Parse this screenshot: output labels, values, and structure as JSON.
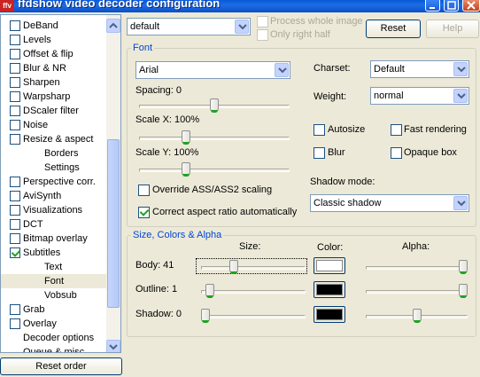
{
  "window": {
    "title": "ffdshow video decoder configuration",
    "icon_text": "ffv"
  },
  "sidebar": {
    "items": [
      {
        "label": "DeBand",
        "checkbox": true,
        "checked": false
      },
      {
        "label": "Levels",
        "checkbox": true,
        "checked": false
      },
      {
        "label": "Offset & flip",
        "checkbox": true,
        "checked": false
      },
      {
        "label": "Blur & NR",
        "checkbox": true,
        "checked": false
      },
      {
        "label": "Sharpen",
        "checkbox": true,
        "checked": false
      },
      {
        "label": "Warpsharp",
        "checkbox": true,
        "checked": false
      },
      {
        "label": "DScaler filter",
        "checkbox": true,
        "checked": false
      },
      {
        "label": "Noise",
        "checkbox": true,
        "checked": false
      },
      {
        "label": "Resize & aspect",
        "checkbox": true,
        "checked": false
      },
      {
        "label": "Borders",
        "checkbox": false,
        "sub": true
      },
      {
        "label": "Settings",
        "checkbox": false,
        "sub": true
      },
      {
        "label": "Perspective corr.",
        "checkbox": true,
        "checked": false
      },
      {
        "label": "AviSynth",
        "checkbox": true,
        "checked": false
      },
      {
        "label": "Visualizations",
        "checkbox": true,
        "checked": false
      },
      {
        "label": "DCT",
        "checkbox": true,
        "checked": false
      },
      {
        "label": "Bitmap overlay",
        "checkbox": true,
        "checked": false
      },
      {
        "label": "Subtitles",
        "checkbox": true,
        "checked": true
      },
      {
        "label": "Text",
        "checkbox": false,
        "sub": true
      },
      {
        "label": "Font",
        "checkbox": false,
        "sub": true,
        "selected": true
      },
      {
        "label": "Vobsub",
        "checkbox": false,
        "sub": true
      },
      {
        "label": "Grab",
        "checkbox": true,
        "checked": false
      },
      {
        "label": "Overlay",
        "checkbox": true,
        "checked": false
      },
      {
        "label": "Decoder options",
        "checkbox": false
      },
      {
        "label": "Queue & misc",
        "checkbox": false
      }
    ],
    "reset_order_label": "Reset order"
  },
  "top": {
    "preset_value": "default",
    "process_whole_image": "Process whole image",
    "only_right_half": "Only right half",
    "reset_label": "Reset",
    "help_label": "Help"
  },
  "font": {
    "group_title": "Font",
    "font_name": "Arial",
    "spacing_label": "Spacing: 0",
    "scale_x_label": "Scale X: 100%",
    "scale_y_label": "Scale Y: 100%",
    "override_label": "Override ASS/ASS2 scaling",
    "override_checked": false,
    "correct_aspect_label": "Correct aspect ratio automatically",
    "correct_aspect_checked": true,
    "charset_label": "Charset:",
    "charset_value": "Default",
    "weight_label": "Weight:",
    "weight_value": "normal",
    "autosize_label": "Autosize",
    "fast_rendering_label": "Fast rendering",
    "blur_label": "Blur",
    "opaque_box_label": "Opaque box",
    "shadow_mode_label": "Shadow mode:",
    "shadow_mode_value": "Classic shadow",
    "spacing_level": 0.5,
    "scale_x_level": 0.3,
    "scale_y_level": 0.3
  },
  "size_colors": {
    "group_title": "Size, Colors & Alpha",
    "size_header": "Size:",
    "color_header": "Color:",
    "alpha_header": "Alpha:",
    "rows": [
      {
        "label": "Body: 41",
        "size_level": 0.3,
        "color": "#ffffff",
        "alpha_level": 1.0
      },
      {
        "label": "Outline: 1",
        "size_level": 0.05,
        "color": "#000000",
        "alpha_level": 1.0
      },
      {
        "label": "Shadow: 0",
        "size_level": 0.0,
        "color": "#000000",
        "alpha_level": 0.5
      }
    ]
  }
}
